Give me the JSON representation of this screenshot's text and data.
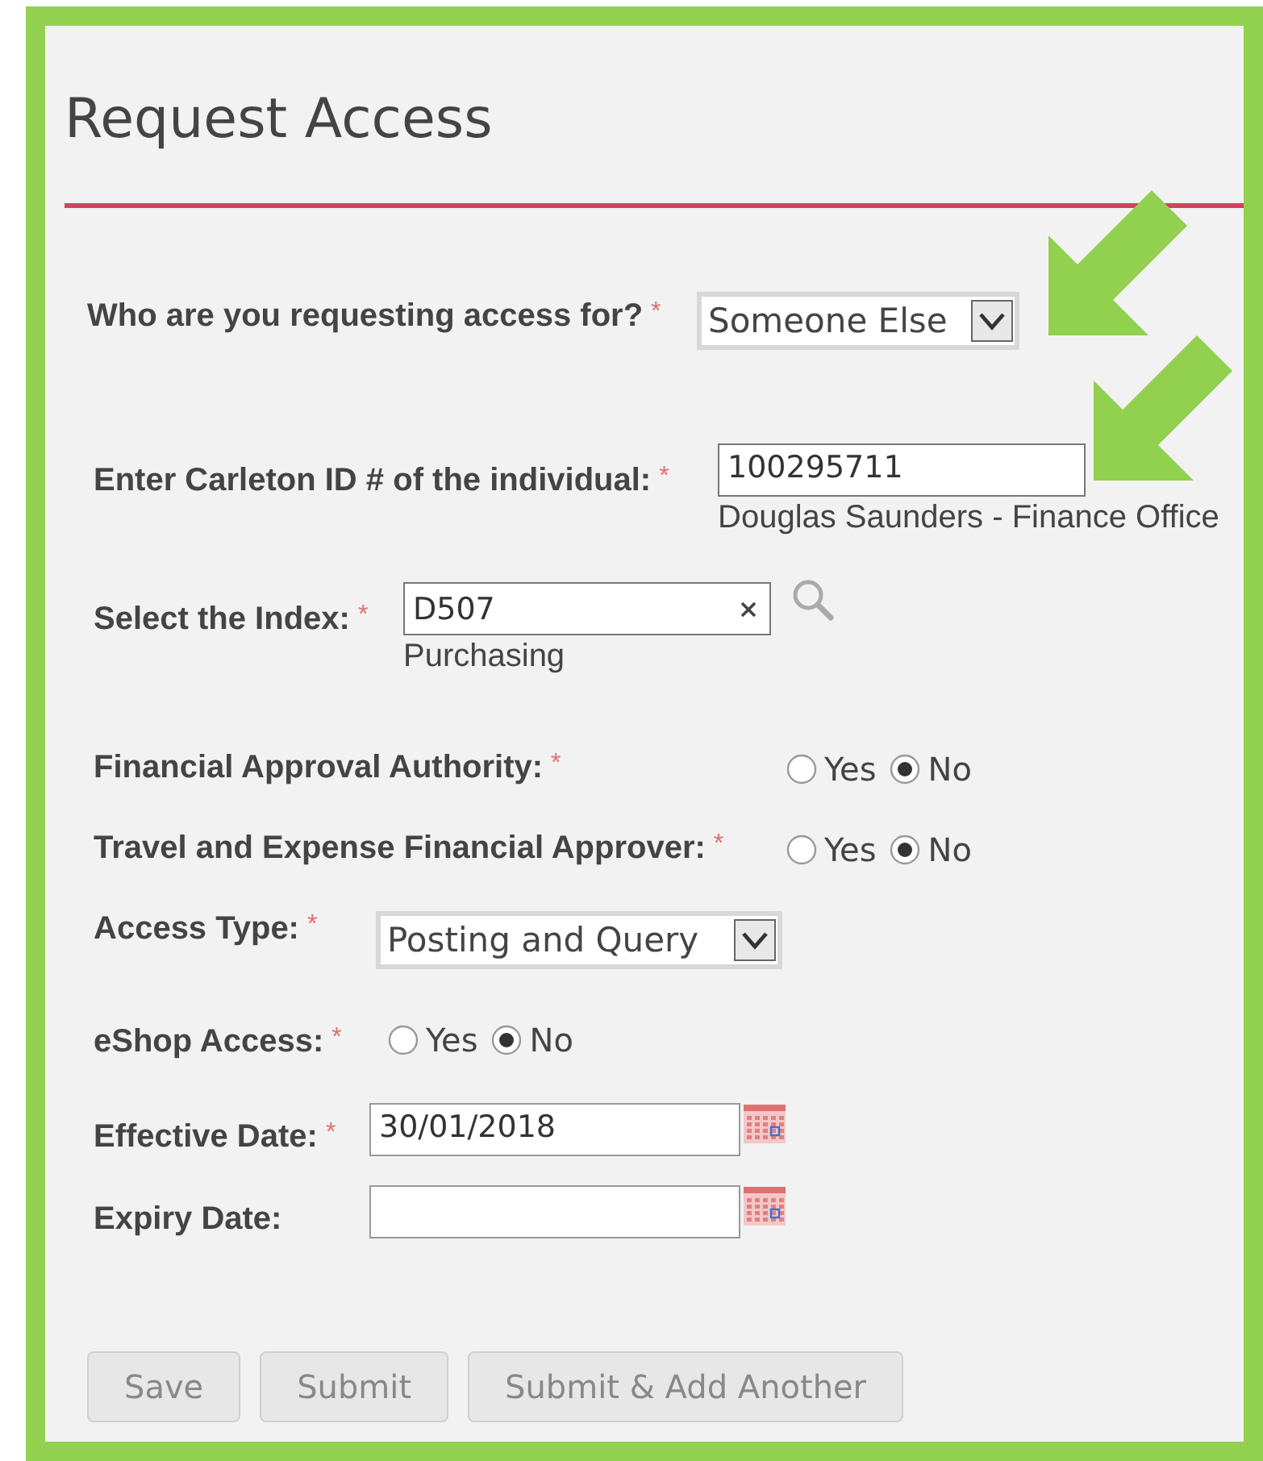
{
  "title": "Request Access",
  "fields": [
    {
      "kind": "select",
      "label": "Who are you requesting access for?",
      "marker": "*",
      "value": "Someone Else"
    },
    {
      "kind": "text",
      "label": "Enter Carleton ID # of the individual:",
      "marker": "*",
      "value": "100295711",
      "note": "Douglas Saunders - Finance Office"
    },
    {
      "kind": "lookup",
      "label": "Select the Index:",
      "marker": "*",
      "value": "D507",
      "note": "Purchasing"
    },
    {
      "kind": "radio",
      "label": "Financial Approval Authority:",
      "marker": "*",
      "options": [
        {
          "label": "Yes",
          "selected": false
        },
        {
          "label": "No",
          "selected": true
        }
      ]
    },
    {
      "kind": "radio",
      "label": "Travel and Expense Financial Approver:",
      "marker": "*",
      "options": [
        {
          "label": "Yes",
          "selected": false
        },
        {
          "label": "No",
          "selected": true
        }
      ]
    },
    {
      "kind": "select",
      "label": "Access Type:",
      "marker": "*",
      "value": "Posting and Query"
    },
    {
      "kind": "radio",
      "label": "eShop Access:",
      "marker": "*",
      "options": [
        {
          "label": "Yes",
          "selected": false
        },
        {
          "label": "No",
          "selected": true
        }
      ]
    },
    {
      "kind": "date",
      "label": "Effective Date:",
      "marker": "*",
      "value": "30/01/2018"
    },
    {
      "kind": "date",
      "label": "Expiry Date:"
    }
  ],
  "buttons": [
    "Save",
    "Submit",
    "Submit & Add Another"
  ]
}
